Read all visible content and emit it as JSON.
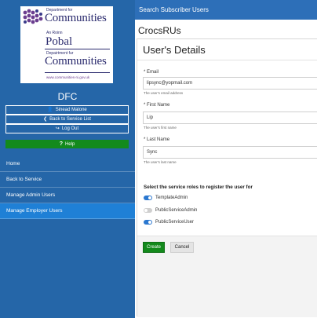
{
  "logo": {
    "line1": "Department for",
    "line2": "Communities",
    "line3": "An Roinn",
    "line4": "Pobal",
    "line5": "Depairtment fur",
    "line6": "Communities",
    "url": "www.communities-ni.gov.uk"
  },
  "sidebar": {
    "org": "DFC",
    "user_name": "Sinead Malone",
    "back_to_service_list": "Back to Service List",
    "logout": "Log Out",
    "help": "Help",
    "nav": [
      {
        "label": "Home",
        "active": false
      },
      {
        "label": "Back to Service",
        "active": false
      },
      {
        "label": "Manage Admin Users",
        "active": false
      },
      {
        "label": "Manage Employer Users",
        "active": true
      }
    ]
  },
  "header": {
    "title": "Search Subscriber Users"
  },
  "main": {
    "company": "CrocsRUs",
    "panel_title": "User's Details",
    "fields": {
      "email": {
        "label": "Email",
        "value": "lipsync@yopmail.com",
        "hint": "The user's email address"
      },
      "first_name": {
        "label": "First Name",
        "value": "Lip",
        "hint": "The user's first name"
      },
      "last_name": {
        "label": "Last Name",
        "value": "Sync",
        "hint": "The user's last name"
      }
    },
    "roles_title": "Select the service roles to register the user for",
    "roles": [
      {
        "label": "TemplateAdmin",
        "enabled": true
      },
      {
        "label": "PublicServiceAdmin",
        "enabled": false
      },
      {
        "label": "PublicServiceUser",
        "enabled": true
      }
    ],
    "create_label": "Create",
    "cancel_label": "Cancel"
  },
  "colors": {
    "sidebar": "#2566a8",
    "topbar": "#2d6fb8",
    "active_nav": "#1f80d6",
    "primary_green": "#138a1c",
    "toggle_on": "#2b78d0"
  }
}
